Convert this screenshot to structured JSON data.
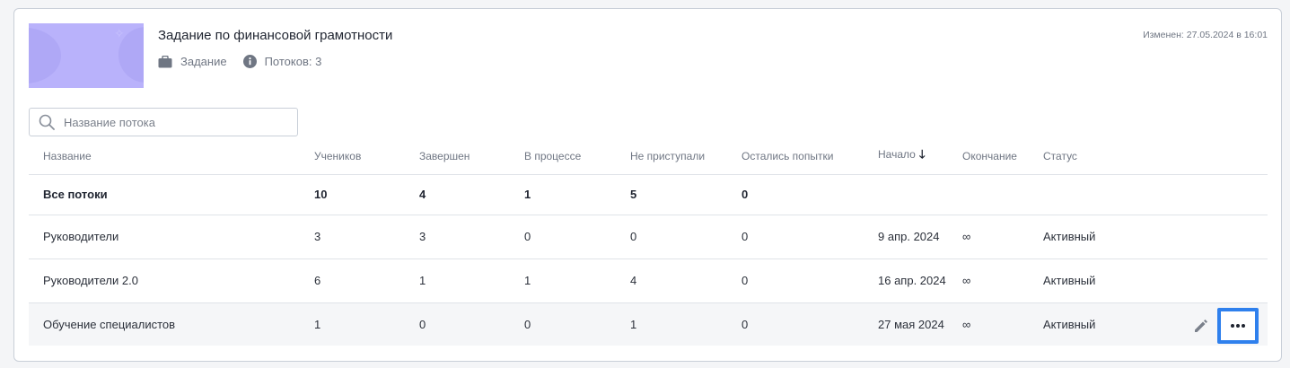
{
  "assignment": {
    "title": "Задание по финансовой грамотности",
    "type_label": "Задание",
    "type_icon": "briefcase-icon",
    "streams_label": "Потоков: 3",
    "streams_icon": "info-icon",
    "modified": "Изменен: 27.05.2024 в 16:01"
  },
  "search": {
    "placeholder": "Название потока",
    "value": ""
  },
  "table": {
    "headers": [
      "Название",
      "Учеников",
      "Завершен",
      "В процессе",
      "Не приступали",
      "Остались попытки",
      "Начало",
      "Окончание",
      "Статус"
    ],
    "sort_column": "Начало",
    "sort_direction": "desc",
    "total_row": {
      "name": "Все потоки",
      "students": "10",
      "completed": "4",
      "in_progress": "1",
      "not_started": "5",
      "attempts_left": "0"
    },
    "rows": [
      {
        "name": "Руководители",
        "students": "3",
        "completed": "3",
        "in_progress": "0",
        "not_started": "0",
        "attempts_left": "0",
        "start": "9 апр. 2024",
        "end": "∞",
        "status": "Активный"
      },
      {
        "name": "Руководители 2.0",
        "students": "6",
        "completed": "1",
        "in_progress": "1",
        "not_started": "4",
        "attempts_left": "0",
        "start": "16 апр. 2024",
        "end": "∞",
        "status": "Активный"
      },
      {
        "name": "Обучение специалистов",
        "students": "1",
        "completed": "0",
        "in_progress": "0",
        "not_started": "1",
        "attempts_left": "0",
        "start": "27 мая 2024",
        "end": "∞",
        "status": "Активный"
      }
    ]
  },
  "actions": {
    "edit_icon": "pencil-icon",
    "more_icon": "more-horizontal-icon"
  },
  "colors": {
    "accent": "#2f80ed",
    "thumbnail": "#b9b2fb",
    "muted_text": "#6f7683"
  }
}
